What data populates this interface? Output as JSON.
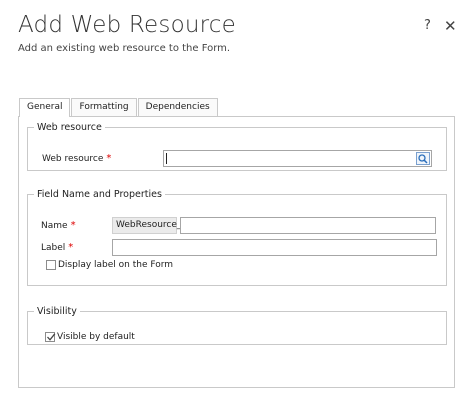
{
  "dialog": {
    "title": "Add Web Resource",
    "subtitle": "Add an existing web resource to the Form.",
    "help_label": "?",
    "close_label": "✕"
  },
  "tabs": [
    {
      "label": "General",
      "active": true
    },
    {
      "label": "Formatting",
      "active": false
    },
    {
      "label": "Dependencies",
      "active": false
    }
  ],
  "web_resource_group": {
    "legend": "Web resource",
    "field_label": "Web resource",
    "required_mark": "*",
    "value": ""
  },
  "field_group": {
    "legend": "Field Name and Properties",
    "name_label": "Name",
    "name_prefix": "WebResource_",
    "name_value": "",
    "label_label": "Label",
    "label_value": "",
    "required_mark": "*",
    "display_label_text": "Display label on the Form",
    "display_label_checked": false
  },
  "visibility_group": {
    "legend": "Visibility",
    "visible_text": "Visible by default",
    "visible_checked": true
  },
  "colors": {
    "required": "#dd0000",
    "border": "#c9c9c9",
    "lookup_icon": "#2a6ebb"
  }
}
